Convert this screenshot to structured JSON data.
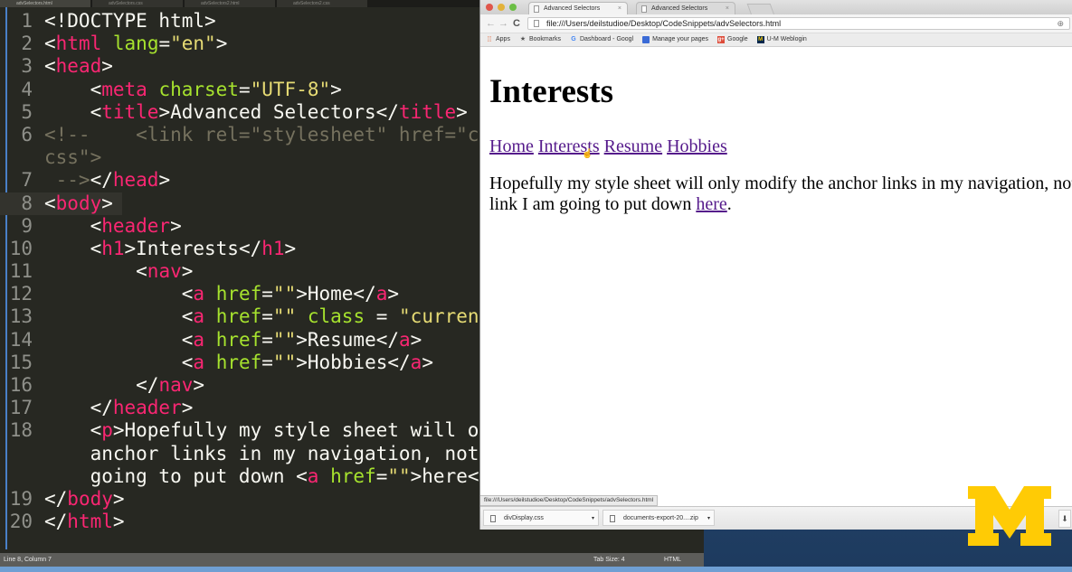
{
  "editor": {
    "tabs": [
      {
        "label": "advSelectors.html",
        "active": true
      },
      {
        "label": "advSelectors.css",
        "active": false
      },
      {
        "label": "advSelectors2.html",
        "active": false
      },
      {
        "label": "advSelectors2.css",
        "active": false
      }
    ],
    "lines": [
      {
        "n": "1",
        "tokens": [
          [
            "t",
            "<!DOCTYPE html>"
          ]
        ]
      },
      {
        "n": "2",
        "tokens": [
          [
            "t",
            "<"
          ],
          [
            "tag",
            "html"
          ],
          [
            "t",
            " "
          ],
          [
            "attr",
            "lang"
          ],
          [
            "t",
            "="
          ],
          [
            "str",
            "\"en\""
          ],
          [
            "t",
            ">"
          ]
        ]
      },
      {
        "n": "3",
        "tokens": [
          [
            "t",
            "<"
          ],
          [
            "tag",
            "head"
          ],
          [
            "t",
            ">"
          ]
        ]
      },
      {
        "n": "4",
        "tokens": [
          [
            "t",
            "    <"
          ],
          [
            "tag",
            "meta"
          ],
          [
            "t",
            " "
          ],
          [
            "attr",
            "charset"
          ],
          [
            "t",
            "="
          ],
          [
            "str",
            "\"UTF-8\""
          ],
          [
            "t",
            ">"
          ]
        ]
      },
      {
        "n": "5",
        "tokens": [
          [
            "t",
            "    <"
          ],
          [
            "tag",
            "title"
          ],
          [
            "t",
            ">Advanced Selectors</"
          ],
          [
            "tag",
            "title"
          ],
          [
            "t",
            ">"
          ]
        ]
      },
      {
        "n": "6",
        "tokens": [
          [
            "cmt",
            "<!--    <link rel=\"stylesheet\" href=\"c"
          ]
        ]
      },
      {
        "n": "",
        "tokens": [
          [
            "cmt",
            "css\">"
          ]
        ]
      },
      {
        "n": "7",
        "tokens": [
          [
            "cmt",
            " -->"
          ],
          [
            "t",
            "</"
          ],
          [
            "tag",
            "head"
          ],
          [
            "t",
            ">"
          ]
        ]
      },
      {
        "n": "8",
        "tokens": [
          [
            "t",
            "<"
          ],
          [
            "tag",
            "body"
          ],
          [
            "t",
            ">"
          ]
        ],
        "current": true
      },
      {
        "n": "9",
        "tokens": [
          [
            "t",
            "    <"
          ],
          [
            "tag",
            "header"
          ],
          [
            "t",
            ">"
          ]
        ]
      },
      {
        "n": "10",
        "tokens": [
          [
            "t",
            "    <"
          ],
          [
            "tag",
            "h1"
          ],
          [
            "t",
            ">Interests</"
          ],
          [
            "tag",
            "h1"
          ],
          [
            "t",
            ">"
          ]
        ]
      },
      {
        "n": "11",
        "tokens": [
          [
            "t",
            "        <"
          ],
          [
            "tag",
            "nav"
          ],
          [
            "t",
            ">"
          ]
        ]
      },
      {
        "n": "12",
        "tokens": [
          [
            "t",
            "            <"
          ],
          [
            "tag",
            "a"
          ],
          [
            "t",
            " "
          ],
          [
            "attr",
            "href"
          ],
          [
            "t",
            "="
          ],
          [
            "str",
            "\"\""
          ],
          [
            "t",
            ">Home</"
          ],
          [
            "tag",
            "a"
          ],
          [
            "t",
            ">"
          ]
        ]
      },
      {
        "n": "13",
        "tokens": [
          [
            "t",
            "            <"
          ],
          [
            "tag",
            "a"
          ],
          [
            "t",
            " "
          ],
          [
            "attr",
            "href"
          ],
          [
            "t",
            "="
          ],
          [
            "str",
            "\"\""
          ],
          [
            "t",
            " "
          ],
          [
            "attr",
            "class"
          ],
          [
            "t",
            " = "
          ],
          [
            "str",
            "\"curren"
          ]
        ]
      },
      {
        "n": "14",
        "tokens": [
          [
            "t",
            "            <"
          ],
          [
            "tag",
            "a"
          ],
          [
            "t",
            " "
          ],
          [
            "attr",
            "href"
          ],
          [
            "t",
            "="
          ],
          [
            "str",
            "\"\""
          ],
          [
            "t",
            ">Resume</"
          ],
          [
            "tag",
            "a"
          ],
          [
            "t",
            ">"
          ]
        ]
      },
      {
        "n": "15",
        "tokens": [
          [
            "t",
            "            <"
          ],
          [
            "tag",
            "a"
          ],
          [
            "t",
            " "
          ],
          [
            "attr",
            "href"
          ],
          [
            "t",
            "="
          ],
          [
            "str",
            "\"\""
          ],
          [
            "t",
            ">Hobbies</"
          ],
          [
            "tag",
            "a"
          ],
          [
            "t",
            ">"
          ]
        ]
      },
      {
        "n": "16",
        "tokens": [
          [
            "t",
            "        </"
          ],
          [
            "tag",
            "nav"
          ],
          [
            "t",
            ">"
          ]
        ]
      },
      {
        "n": "17",
        "tokens": [
          [
            "t",
            "    </"
          ],
          [
            "tag",
            "header"
          ],
          [
            "t",
            ">"
          ]
        ]
      },
      {
        "n": "18",
        "tokens": [
          [
            "t",
            "    <"
          ],
          [
            "tag",
            "p"
          ],
          [
            "t",
            ">Hopefully my style sheet will o"
          ]
        ]
      },
      {
        "n": "",
        "tokens": [
          [
            "t",
            "    anchor links in my navigation, not"
          ]
        ]
      },
      {
        "n": "",
        "tokens": [
          [
            "t",
            "    going to put down <"
          ],
          [
            "tag",
            "a"
          ],
          [
            "t",
            " "
          ],
          [
            "attr",
            "href"
          ],
          [
            "t",
            "="
          ],
          [
            "str",
            "\"\""
          ],
          [
            "t",
            ">here<"
          ]
        ]
      },
      {
        "n": "19",
        "tokens": [
          [
            "t",
            "</"
          ],
          [
            "tag",
            "body"
          ],
          [
            "t",
            ">"
          ]
        ]
      },
      {
        "n": "20",
        "tokens": [
          [
            "t",
            "</"
          ],
          [
            "tag",
            "html"
          ],
          [
            "t",
            ">"
          ]
        ]
      }
    ],
    "status": {
      "position": "Line 8, Column 7",
      "tab_size": "Tab Size: 4",
      "syntax": "HTML"
    }
  },
  "browser": {
    "tabs": [
      {
        "label": "Advanced Selectors",
        "active": true
      },
      {
        "label": "Advanced Selectors",
        "active": false
      }
    ],
    "tab_close": "×",
    "nav": {
      "back": "←",
      "forward": "→",
      "reload": "C"
    },
    "url": "file:///Users/deilstudioe/Desktop/CodeSnippets/advSelectors.html",
    "bookmarks": [
      {
        "label": "Apps",
        "icon": "apps-icon"
      },
      {
        "label": "Bookmarks",
        "icon": "star-icon"
      },
      {
        "label": "Dashboard - Googl",
        "icon": "google-icon"
      },
      {
        "label": "Manage your pages",
        "icon": "manage-pages-icon"
      },
      {
        "label": "Google",
        "icon": "google-plus-icon"
      },
      {
        "label": "U-M Weblogin",
        "icon": "um-icon"
      }
    ],
    "page": {
      "heading": "Interests",
      "nav_links": [
        "Home",
        "Interests",
        "Resume",
        "Hobbies"
      ],
      "paragraph_before": "Hopefully my style sheet will only modify the anchor links in my navigation, not the link I am going to put down ",
      "paragraph_link": "here",
      "paragraph_after": "."
    },
    "status_url": "file:///Users/deilstudioe/Desktop/CodeSnippets/advSelectors.html",
    "downloads": [
      {
        "label": "divDisplay.css"
      },
      {
        "label": "documents-export-20....zip"
      }
    ],
    "downloads_show_all": "⬇"
  },
  "colors": {
    "editor_bg": "#272822",
    "tag": "#f92672",
    "attr": "#a6e22e",
    "string": "#e6db74",
    "link_visited": "#551a8b",
    "um_maize": "#ffcb05"
  }
}
